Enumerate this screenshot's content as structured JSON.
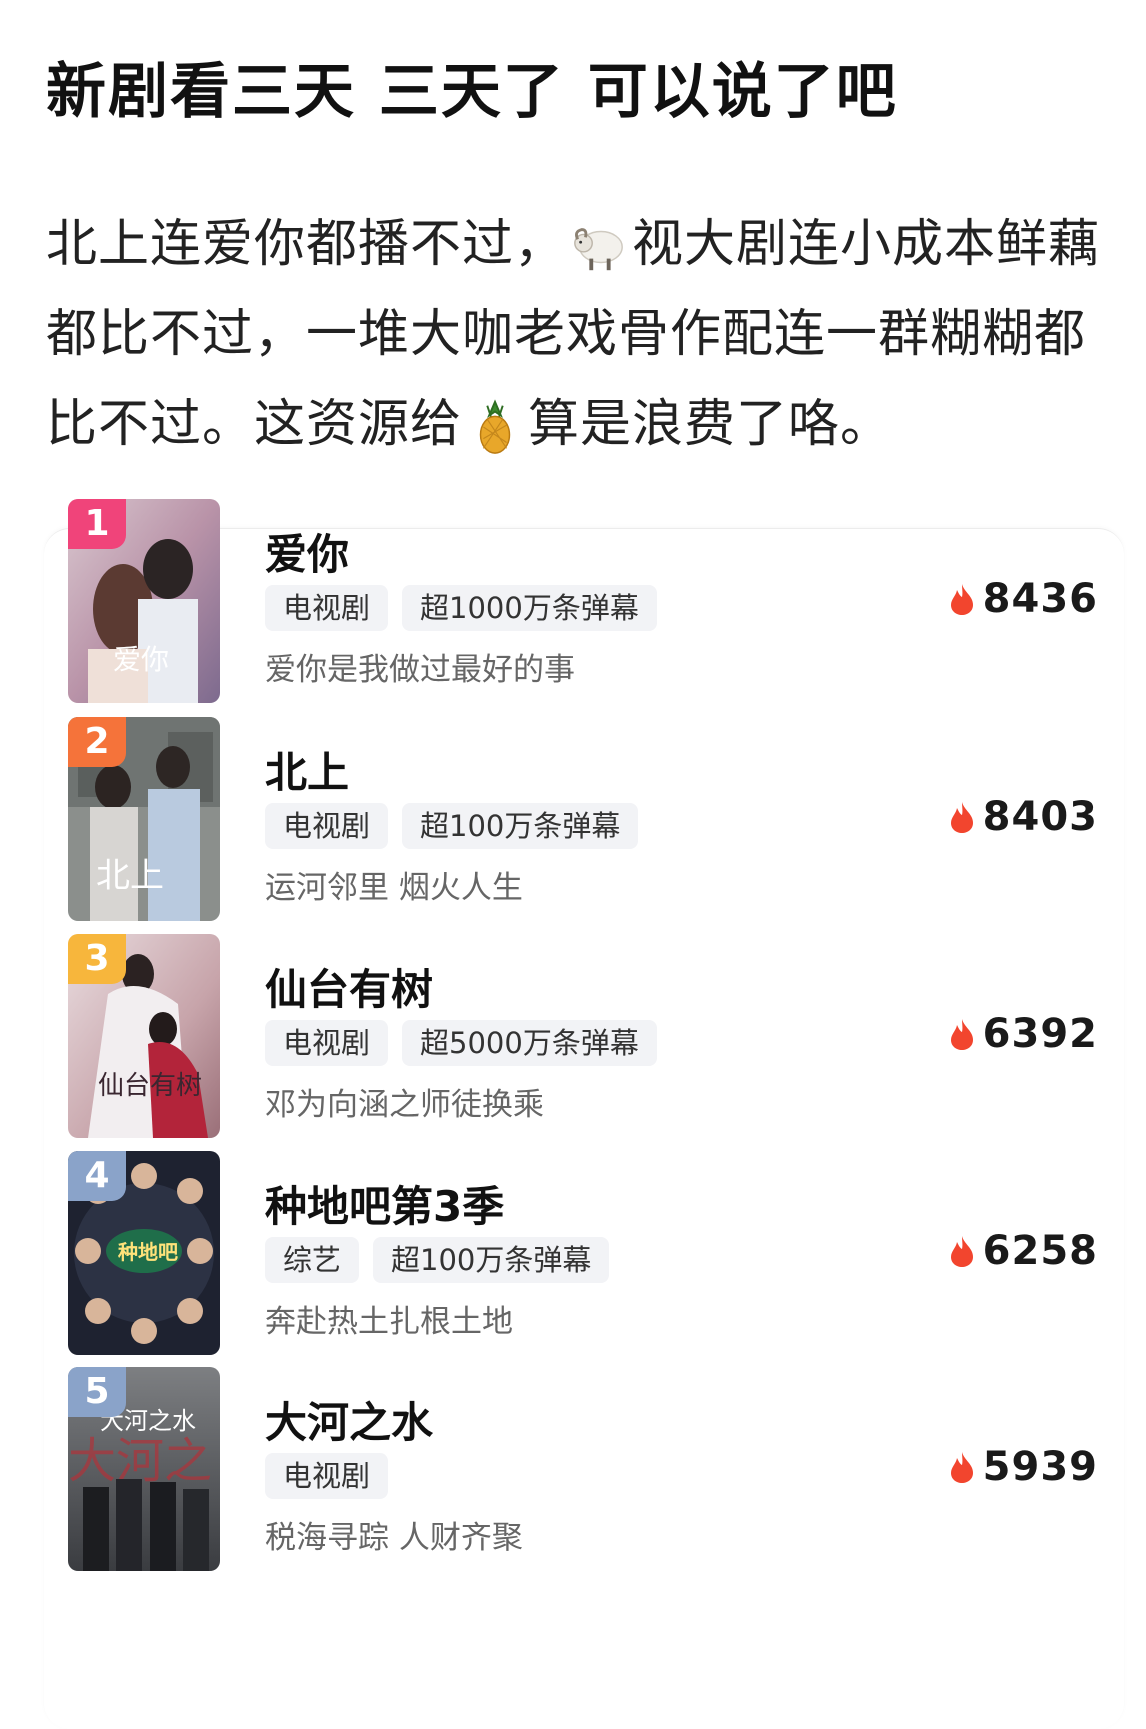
{
  "post": {
    "title": "新剧看三天 三天了 可以说了吧",
    "body_part1": "北上连爱你都播不过，",
    "emoji_1": "sheep-emoji",
    "body_part2": "视大剧连小成本鲜藕都比不过，一堆大咖老戏骨作配连一群糊糊都比不过。这资源给",
    "emoji_2": "pineapple-emoji",
    "body_part3": "算是浪费了咯。"
  },
  "ranking": {
    "items": [
      {
        "rank": "1",
        "badge_color": "#f0447a",
        "title": "爱你",
        "tags": [
          "电视剧",
          "超1000万条弹幕"
        ],
        "desc": "爱你是我做过最好的事",
        "heat": "8436",
        "poster_text": "爱你"
      },
      {
        "rank": "2",
        "badge_color": "#f5733a",
        "title": "北上",
        "tags": [
          "电视剧",
          "超100万条弹幕"
        ],
        "desc": "运河邻里 烟火人生",
        "heat": "8403",
        "poster_text": "北上"
      },
      {
        "rank": "3",
        "badge_color": "#f7b63c",
        "title": "仙台有树",
        "tags": [
          "电视剧",
          "超5000万条弹幕"
        ],
        "desc": "邓为向涵之师徒换乘",
        "heat": "6392",
        "poster_text": "仙台有树"
      },
      {
        "rank": "4",
        "badge_color": "#8aa3c9",
        "title": "种地吧第3季",
        "tags": [
          "综艺",
          "超100万条弹幕"
        ],
        "desc": "奔赴热土扎根土地",
        "heat": "6258",
        "poster_text": "种地吧"
      },
      {
        "rank": "5",
        "badge_color": "#8aa3c9",
        "title": "大河之水",
        "tags": [
          "电视剧"
        ],
        "desc": "税海寻踪 人财齐聚",
        "heat": "5939",
        "poster_text": "大河之水"
      }
    ]
  },
  "icons": {
    "heat": "flame-icon"
  },
  "colors": {
    "flame": "#f2452e"
  }
}
